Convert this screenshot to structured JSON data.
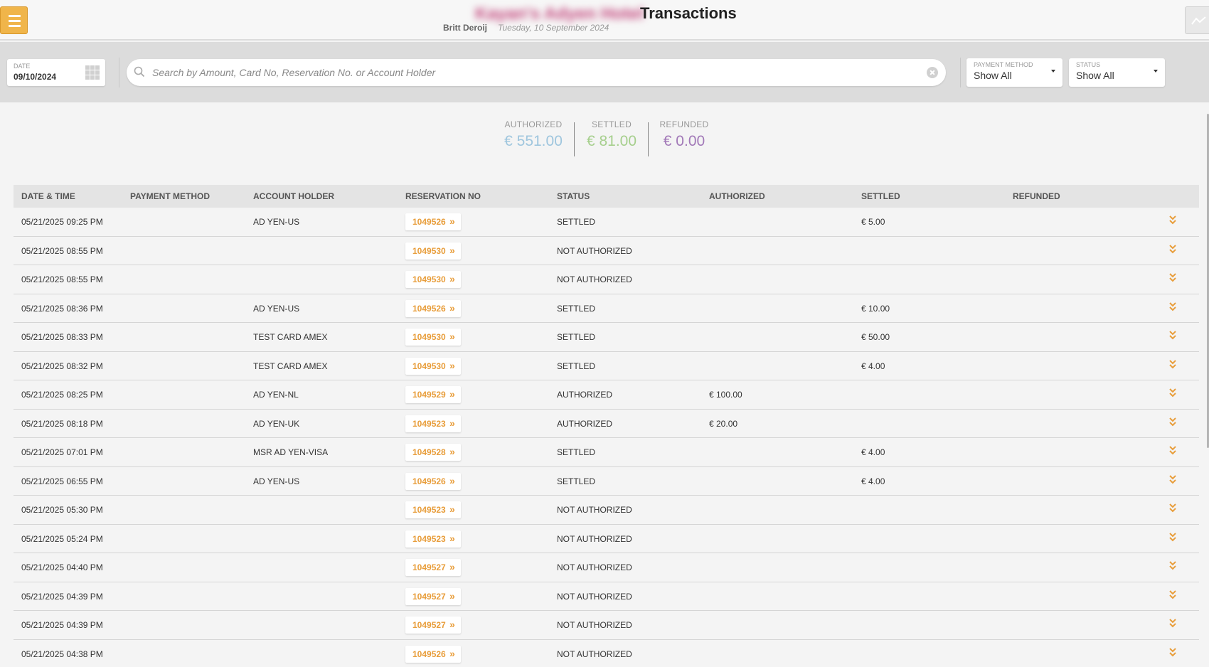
{
  "header": {
    "hotel_name": "Kayan's Adyen Hotel",
    "title": "Transactions",
    "user": "Britt Deroij",
    "date": "Tuesday, 10 September 2024"
  },
  "filters": {
    "date_label": "DATE",
    "date_value": "09/10/2024",
    "search_placeholder": "Search by Amount, Card No, Reservation No. or Account Holder",
    "payment_method_label": "PAYMENT METHOD",
    "payment_method_value": "Show All",
    "status_label": "STATUS",
    "status_value": "Show All"
  },
  "totals": {
    "authorized_label": "AUTHORIZED",
    "authorized_value": "€ 551.00",
    "settled_label": "SETTLED",
    "settled_value": "€ 81.00",
    "refunded_label": "REFUNDED",
    "refunded_value": "€ 0.00"
  },
  "table": {
    "columns": [
      "DATE & TIME",
      "PAYMENT METHOD",
      "ACCOUNT HOLDER",
      "RESERVATION NO",
      "STATUS",
      "AUTHORIZED",
      "SETTLED",
      "REFUNDED"
    ],
    "rows": [
      {
        "datetime": "05/21/2025 09:25 PM",
        "payment_method": "",
        "account_holder": "AD YEN-US",
        "reservation": "1049526",
        "status": "SETTLED",
        "authorized": "",
        "settled": "€ 5.00",
        "refunded": ""
      },
      {
        "datetime": "05/21/2025 08:55 PM",
        "payment_method": "",
        "account_holder": "",
        "reservation": "1049530",
        "status": "NOT AUTHORIZED",
        "authorized": "",
        "settled": "",
        "refunded": ""
      },
      {
        "datetime": "05/21/2025 08:55 PM",
        "payment_method": "",
        "account_holder": "",
        "reservation": "1049530",
        "status": "NOT AUTHORIZED",
        "authorized": "",
        "settled": "",
        "refunded": ""
      },
      {
        "datetime": "05/21/2025 08:36 PM",
        "payment_method": "",
        "account_holder": "AD YEN-US",
        "reservation": "1049526",
        "status": "SETTLED",
        "authorized": "",
        "settled": "€ 10.00",
        "refunded": ""
      },
      {
        "datetime": "05/21/2025 08:33 PM",
        "payment_method": "",
        "account_holder": "TEST CARD AMEX",
        "reservation": "1049530",
        "status": "SETTLED",
        "authorized": "",
        "settled": "€ 50.00",
        "refunded": ""
      },
      {
        "datetime": "05/21/2025 08:32 PM",
        "payment_method": "",
        "account_holder": "TEST CARD AMEX",
        "reservation": "1049530",
        "status": "SETTLED",
        "authorized": "",
        "settled": "€ 4.00",
        "refunded": ""
      },
      {
        "datetime": "05/21/2025 08:25 PM",
        "payment_method": "",
        "account_holder": "AD YEN-NL",
        "reservation": "1049529",
        "status": "AUTHORIZED",
        "authorized": "€ 100.00",
        "settled": "",
        "refunded": ""
      },
      {
        "datetime": "05/21/2025 08:18 PM",
        "payment_method": "",
        "account_holder": "AD YEN-UK",
        "reservation": "1049523",
        "status": "AUTHORIZED",
        "authorized": "€ 20.00",
        "settled": "",
        "refunded": ""
      },
      {
        "datetime": "05/21/2025 07:01 PM",
        "payment_method": "",
        "account_holder": "MSR AD YEN-VISA",
        "reservation": "1049528",
        "status": "SETTLED",
        "authorized": "",
        "settled": "€ 4.00",
        "refunded": ""
      },
      {
        "datetime": "05/21/2025 06:55 PM",
        "payment_method": "",
        "account_holder": "AD YEN-US",
        "reservation": "1049526",
        "status": "SETTLED",
        "authorized": "",
        "settled": "€ 4.00",
        "refunded": ""
      },
      {
        "datetime": "05/21/2025 05:30 PM",
        "payment_method": "",
        "account_holder": "",
        "reservation": "1049523",
        "status": "NOT AUTHORIZED",
        "authorized": "",
        "settled": "",
        "refunded": ""
      },
      {
        "datetime": "05/21/2025 05:24 PM",
        "payment_method": "",
        "account_holder": "",
        "reservation": "1049523",
        "status": "NOT AUTHORIZED",
        "authorized": "",
        "settled": "",
        "refunded": ""
      },
      {
        "datetime": "05/21/2025 04:40 PM",
        "payment_method": "",
        "account_holder": "",
        "reservation": "1049527",
        "status": "NOT AUTHORIZED",
        "authorized": "",
        "settled": "",
        "refunded": ""
      },
      {
        "datetime": "05/21/2025 04:39 PM",
        "payment_method": "",
        "account_holder": "",
        "reservation": "1049527",
        "status": "NOT AUTHORIZED",
        "authorized": "",
        "settled": "",
        "refunded": ""
      },
      {
        "datetime": "05/21/2025 04:39 PM",
        "payment_method": "",
        "account_holder": "",
        "reservation": "1049527",
        "status": "NOT AUTHORIZED",
        "authorized": "",
        "settled": "",
        "refunded": ""
      },
      {
        "datetime": "05/21/2025 04:38 PM",
        "payment_method": "",
        "account_holder": "",
        "reservation": "1049526",
        "status": "NOT AUTHORIZED",
        "authorized": "",
        "settled": "",
        "refunded": ""
      }
    ]
  },
  "icons": {
    "menu": "hamburger-icon",
    "activity": "activity-chart-icon",
    "calendar": "calendar-grid-icon",
    "search": "search-icon",
    "clear": "clear-icon",
    "dropdown": "caret-down-icon",
    "reservation_link": "double-chevron-right-icon",
    "expand": "double-chevron-down-icon"
  },
  "colors": {
    "accent": "#f0b54a",
    "link": "#e89d3a",
    "authorized": "#9fc6de",
    "settled": "#a6cf8d",
    "refunded": "#a279b8"
  }
}
